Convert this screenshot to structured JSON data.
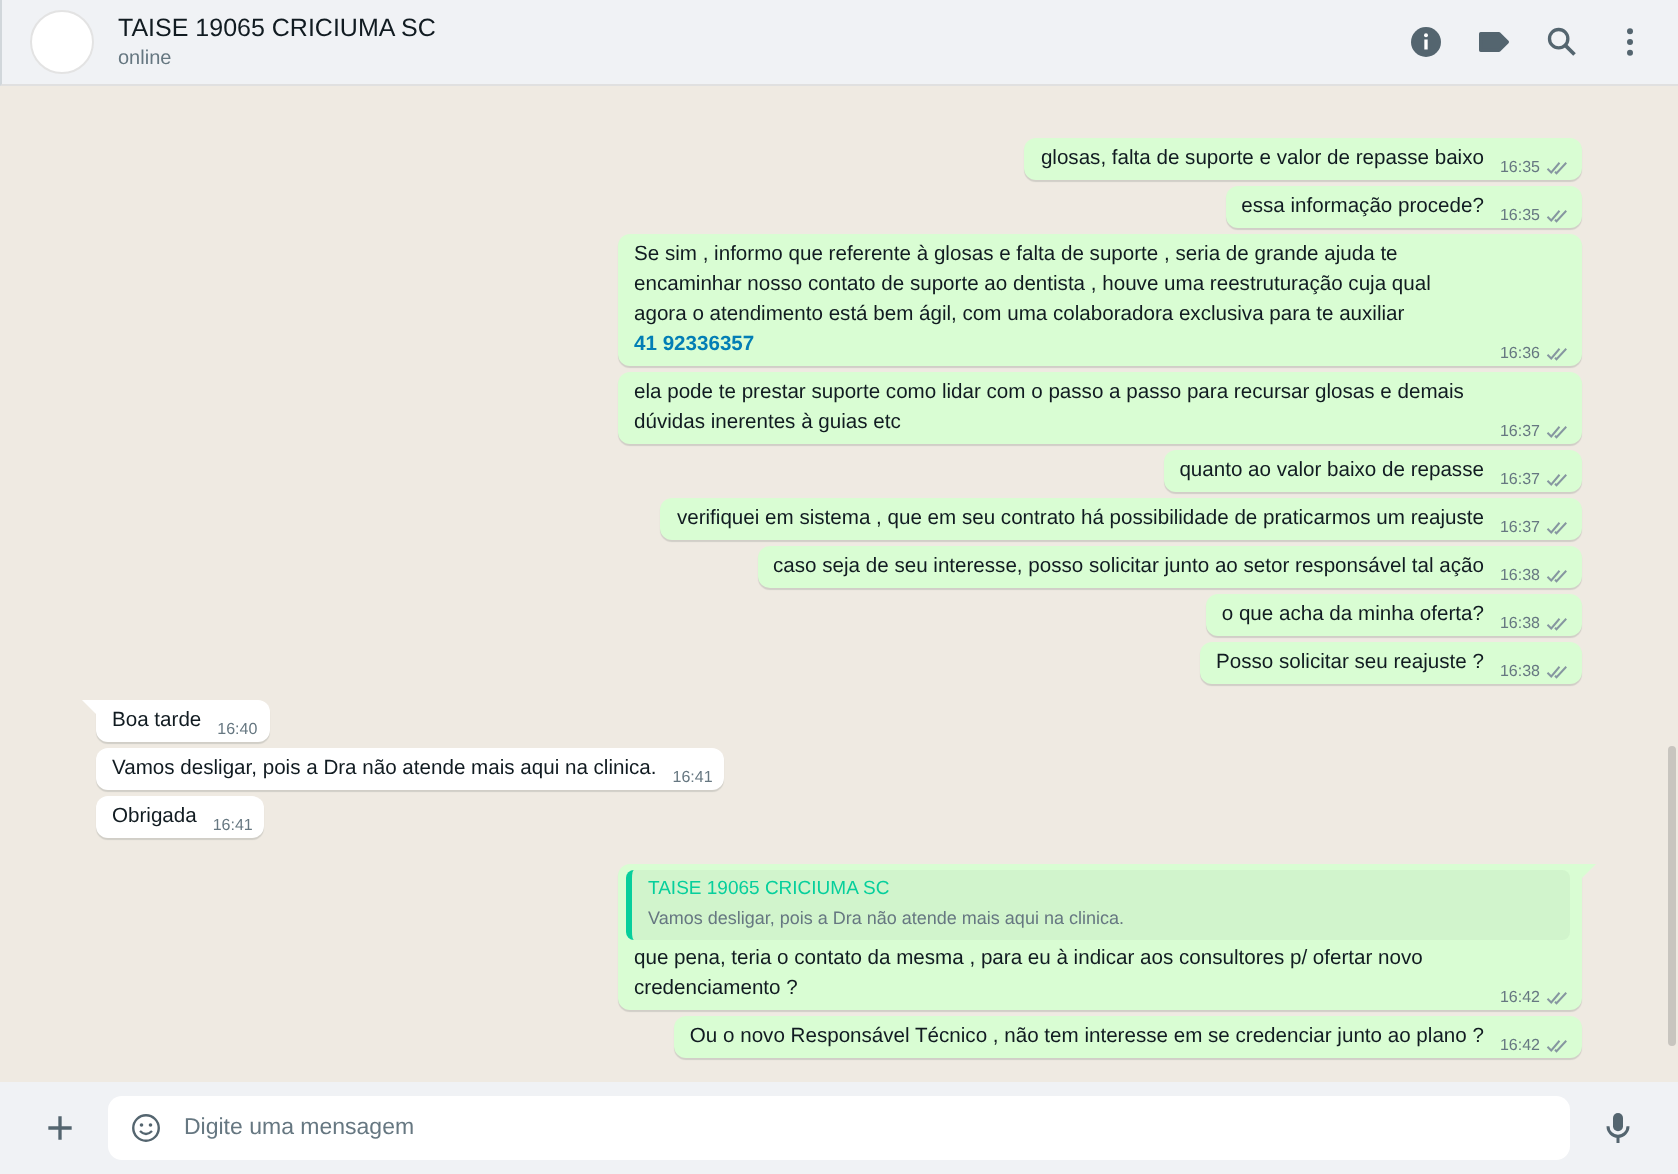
{
  "header": {
    "title": "TAISE 19065 CRICIUMA SC",
    "status": "online"
  },
  "messages": [
    {
      "kind": "out",
      "text": "glosas, falta de suporte e valor de repasse baixo",
      "time": "16:35",
      "read": false
    },
    {
      "kind": "out",
      "text": "essa informação procede?",
      "time": "16:35",
      "read": false
    },
    {
      "kind": "out",
      "text": "Se sim , informo que referente à glosas e falta de suporte , seria de grande ajuda te encaminhar nosso contato de suporte ao dentista , houve uma reestruturação cuja qual agora o atendimento está bem ágil, com uma colaboradora exclusiva para te auxiliar",
      "link": "41 92336357",
      "time": "16:36",
      "read": false
    },
    {
      "kind": "out",
      "text": "ela pode te prestar suporte como lidar com o passo a passo para recursar glosas e demais dúvidas inerentes à guias etc",
      "time": "16:37",
      "read": false
    },
    {
      "kind": "out",
      "text": "quanto ao valor baixo de repasse",
      "time": "16:37",
      "read": false
    },
    {
      "kind": "out",
      "text": "verifiquei em sistema , que em seu contrato há possibilidade de praticarmos um reajuste",
      "time": "16:37",
      "read": false
    },
    {
      "kind": "out",
      "text": "caso seja de seu interesse, posso solicitar junto ao setor responsável tal ação",
      "time": "16:38",
      "read": false
    },
    {
      "kind": "out",
      "text": "o que acha da minha oferta?",
      "time": "16:38",
      "read": false
    },
    {
      "kind": "out",
      "text": "Posso solicitar seu reajuste ?",
      "time": "16:38",
      "read": false
    },
    {
      "kind": "in",
      "text": "Boa tarde",
      "time": "16:40",
      "tail": true
    },
    {
      "kind": "in",
      "text": "Vamos desligar, pois a Dra não atende mais aqui na clinica.",
      "time": "16:41"
    },
    {
      "kind": "in",
      "text": "Obrigada",
      "time": "16:41"
    },
    {
      "kind": "out",
      "quote": {
        "author": "TAISE 19065 CRICIUMA SC",
        "text": "Vamos desligar, pois a Dra não atende mais aqui na clinica."
      },
      "text": "que pena, teria o contato da mesma , para eu à indicar aos consultores p/ ofertar novo credenciamento ?",
      "time": "16:42",
      "read": false,
      "tail": true
    },
    {
      "kind": "out",
      "text": "Ou o novo Responsável Técnico , não tem interesse em se credenciar junto ao plano ?",
      "time": "16:42",
      "read": false
    }
  ],
  "composer": {
    "placeholder": "Digite uma mensagem"
  }
}
